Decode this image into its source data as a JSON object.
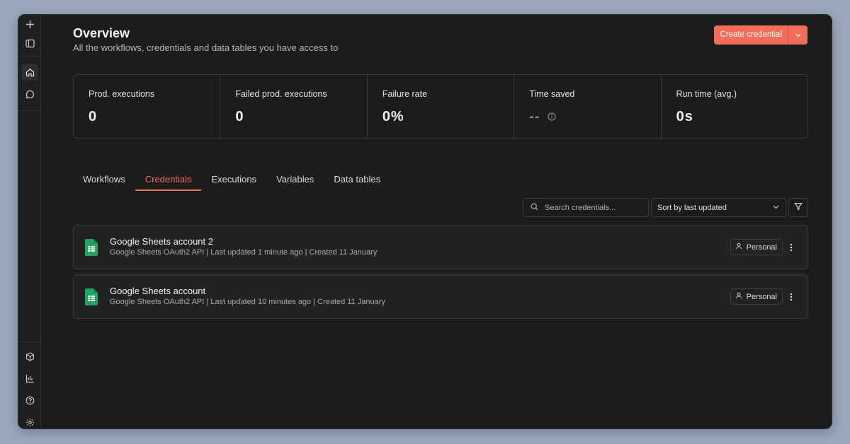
{
  "header": {
    "title": "Overview",
    "subtitle": "All the workflows, credentials and data tables you have access to",
    "create_label": "Create credential"
  },
  "stats": [
    {
      "label": "Prod. executions",
      "value": "0"
    },
    {
      "label": "Failed prod. executions",
      "value": "0"
    },
    {
      "label": "Failure rate",
      "value": "0%"
    },
    {
      "label": "Time saved",
      "value": "--"
    },
    {
      "label": "Run time (avg.)",
      "value": "0s"
    }
  ],
  "tabs": [
    {
      "label": "Workflows"
    },
    {
      "label": "Credentials",
      "active": true
    },
    {
      "label": "Executions"
    },
    {
      "label": "Variables"
    },
    {
      "label": "Data tables"
    }
  ],
  "toolbar": {
    "search_placeholder": "Search credentials...",
    "sort_value": "Sort by last updated"
  },
  "credentials": [
    {
      "name": "Google Sheets account 2",
      "meta": "Google Sheets OAuth2 API | Last updated 1 minute ago | Created 11 January",
      "badge": "Personal"
    },
    {
      "name": "Google Sheets account",
      "meta": "Google Sheets OAuth2 API | Last updated 10 minutes ago | Created 11 January",
      "badge": "Personal"
    }
  ],
  "colors": {
    "accent": "#f26c5a",
    "sheets_green": "#1fa463"
  },
  "icons": [
    "plus-icon",
    "sidebar-toggle-icon",
    "home-icon",
    "chat-icon",
    "cube-icon",
    "bar-chart-icon",
    "help-icon",
    "gear-icon",
    "search-icon",
    "chevron-down-icon",
    "filter-icon",
    "info-icon",
    "user-icon",
    "more-vertical-icon",
    "google-sheets-icon"
  ]
}
